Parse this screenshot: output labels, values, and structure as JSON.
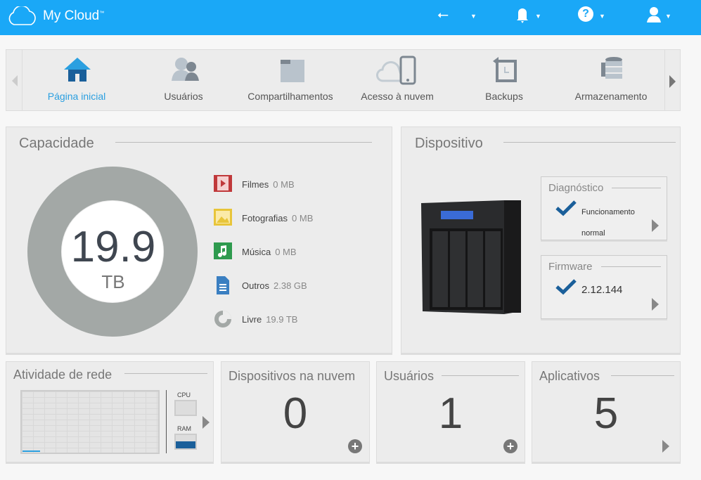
{
  "header": {
    "app_title": "My Cloud",
    "trademark": "™",
    "icons": [
      "usb-icon",
      "bell-icon",
      "help-icon",
      "user-icon"
    ]
  },
  "nav": {
    "items": [
      {
        "label": "Página inicial",
        "icon": "home-icon",
        "active": true
      },
      {
        "label": "Usuários",
        "icon": "users-icon"
      },
      {
        "label": "Compartilhamentos",
        "icon": "folder-icon"
      },
      {
        "label": "Acesso à nuvem",
        "icon": "cloud-phone-icon"
      },
      {
        "label": "Backups",
        "icon": "backup-icon"
      },
      {
        "label": "Armazenamento",
        "icon": "storage-icon"
      }
    ]
  },
  "capacity": {
    "title": "Capacidade",
    "total": "19.9",
    "unit": "TB",
    "legend": [
      {
        "label": "Filmes",
        "value": "0 MB",
        "icon": "film-icon",
        "color": "#c0393b"
      },
      {
        "label": "Fotografias",
        "value": "0 MB",
        "icon": "photo-icon",
        "color": "#e8c53a"
      },
      {
        "label": "Música",
        "value": "0 MB",
        "icon": "music-icon",
        "color": "#2e9a4e"
      },
      {
        "label": "Outros",
        "value": "2.38 GB",
        "icon": "document-icon",
        "color": "#3a7fc1"
      },
      {
        "label": "Livre",
        "value": "19.9 TB",
        "icon": "pie-icon",
        "color": "#a3a8a6"
      }
    ]
  },
  "device": {
    "title": "Dispositivo",
    "diagnostics": {
      "title": "Diagnóstico",
      "status_line1": "Funcionamento",
      "status_line2": "normal"
    },
    "firmware": {
      "title": "Firmware",
      "version": "2.12.144"
    }
  },
  "network": {
    "title": "Atividade de rede",
    "cpu_label": "CPU",
    "ram_label": "RAM",
    "cpu_percent": 0,
    "ram_percent": 55
  },
  "cloud_devices": {
    "title": "Dispositivos na nuvem",
    "count": "0"
  },
  "users": {
    "title": "Usuários",
    "count": "1"
  },
  "apps": {
    "title": "Aplicativos",
    "count": "5"
  },
  "colors": {
    "header": "#1aa8f7",
    "accent": "#1a6fad",
    "active_nav": "#2a9fe0"
  }
}
